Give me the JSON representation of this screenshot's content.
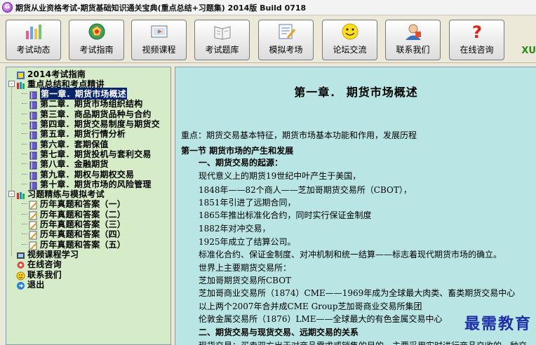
{
  "window": {
    "title": "期货从业资格考试-期货基础知识通关宝典(重点总结+习题集) 2014版 Build 0718"
  },
  "toolbar": {
    "buttons": [
      {
        "label": "考试动态",
        "icon": "news-bars-icon"
      },
      {
        "label": "考试指南",
        "icon": "compass-pentagon-icon"
      },
      {
        "label": "视频课程",
        "icon": "video-course-icon"
      },
      {
        "label": "考试题库",
        "icon": "question-bank-icon"
      },
      {
        "label": "模拟考场",
        "icon": "mock-exam-icon"
      },
      {
        "label": "论坛交流",
        "icon": "smiley-forum-icon"
      },
      {
        "label": "联系我们",
        "icon": "contact-person-icon"
      },
      {
        "label": "在线咨询",
        "icon": "question-mark-icon"
      }
    ],
    "brand_partial": "XU"
  },
  "tree": {
    "items": [
      {
        "label": "2014考试指南",
        "level": 0,
        "icon": "guide-icon"
      },
      {
        "label": "重点总结和考点精讲",
        "level": 0,
        "icon": "books-icon",
        "expanded": true
      },
      {
        "label": "第一章．期货市场概述",
        "level": 1,
        "icon": "book-icon",
        "selected": true
      },
      {
        "label": "第二章．期货市场组织结构",
        "level": 1,
        "icon": "book-icon"
      },
      {
        "label": "第三章．商品期货品种与合约",
        "level": 1,
        "icon": "book-icon"
      },
      {
        "label": "第四章．期货交易制度与期货交",
        "level": 1,
        "icon": "book-icon"
      },
      {
        "label": "第五章．期货行情分析",
        "level": 1,
        "icon": "book-icon"
      },
      {
        "label": "第六章．套期保值",
        "level": 1,
        "icon": "book-icon"
      },
      {
        "label": "第七章．期货投机与套利交易",
        "level": 1,
        "icon": "book-icon"
      },
      {
        "label": "第八章．金融期货",
        "level": 1,
        "icon": "book-icon"
      },
      {
        "label": "第九章．期权与期权交易",
        "level": 1,
        "icon": "book-icon"
      },
      {
        "label": "第十章．期货市场的风险管理",
        "level": 1,
        "icon": "book-icon"
      },
      {
        "label": "习题精练与模拟考试",
        "level": 0,
        "icon": "books-icon",
        "expanded": true
      },
      {
        "label": "历年真题和答案（一）",
        "level": 1,
        "icon": "pencil-icon"
      },
      {
        "label": "历年真题和答案（二）",
        "level": 1,
        "icon": "pencil-icon"
      },
      {
        "label": "历年真题和答案（三）",
        "level": 1,
        "icon": "pencil-icon"
      },
      {
        "label": "历年真题和答案（四）",
        "level": 1,
        "icon": "pencil-icon"
      },
      {
        "label": "历年真题和答案（五）",
        "level": 1,
        "icon": "pencil-icon"
      },
      {
        "label": "视频课程学习",
        "level": 0,
        "icon": "film-icon"
      },
      {
        "label": "在线咨询",
        "level": 0,
        "icon": "chat-icon"
      },
      {
        "label": "联系我们",
        "level": 0,
        "icon": "smiley-icon"
      },
      {
        "label": "退出",
        "level": 0,
        "icon": "exit-icon"
      }
    ]
  },
  "content": {
    "chapter_title": "第一章．  期货市场概述",
    "lines": [
      {
        "text": "重点：期货交易基本特征，期货市场基本功能和作用，发展历程",
        "bold": false,
        "indent": 0
      },
      {
        "text": "第一节  期货市场的产生和发展",
        "bold": true,
        "indent": 0
      },
      {
        "text": "一、期货交易的起源：",
        "bold": true,
        "indent": 2
      },
      {
        "text": "现代意义上的期货19世纪中叶产生于美国，",
        "bold": false,
        "indent": 2
      },
      {
        "text": "1848年——82个商人——芝加哥期货交易所（CBOT），",
        "bold": false,
        "indent": 2
      },
      {
        "text": "1851年引进了远期合同，",
        "bold": false,
        "indent": 2
      },
      {
        "text": "1865年推出标准化合约，同时实行保证金制度",
        "bold": false,
        "indent": 2
      },
      {
        "text": "1882年对冲交易，",
        "bold": false,
        "indent": 2
      },
      {
        "text": "1925年成立了结算公司。",
        "bold": false,
        "indent": 2
      },
      {
        "text": "标准化合约、保证金制度、对冲机制和统一结算——标志着现代期货市场的确立。",
        "bold": false,
        "indent": 2
      },
      {
        "text": "世界上主要期货交易所：",
        "bold": false,
        "indent": 2
      },
      {
        "text": "芝加哥期货交易所CBOT",
        "bold": false,
        "indent": 2
      },
      {
        "text": "芝加哥商业交易所（1874）CME——1969年成为全球最大肉类、畜类期货交易中心",
        "bold": false,
        "indent": 2
      },
      {
        "text": "以上两个2007年合并成CME Group芝加哥商业交易所集团",
        "bold": false,
        "indent": 2
      },
      {
        "text": "伦敦金属交易所（1876）LME——全球最大的有色金属交易中心",
        "bold": false,
        "indent": 2
      },
      {
        "text": "二、期货交易与现货交易、远期交易的关系",
        "bold": true,
        "indent": 2
      },
      {
        "text": "现货交易：买卖双方出于对商品需求或销售的目的，主要采用实时进行商品交收的一种交",
        "bold": false,
        "indent": 2
      }
    ],
    "watermark": "最需教育"
  },
  "colors": {
    "sidebar_bg": "#d6ecc8",
    "content_bg": "#b9e6e5",
    "selection": "#0a246a",
    "watermark": "#1f2fa8"
  }
}
